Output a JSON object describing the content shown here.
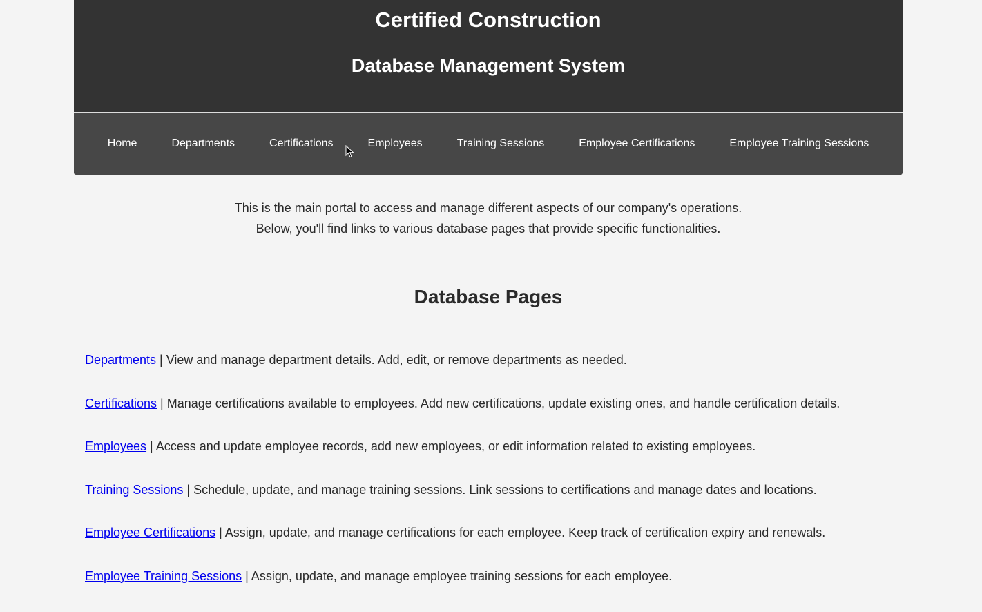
{
  "header": {
    "title": "Certified Construction",
    "subtitle": "Database Management System"
  },
  "nav": {
    "items": [
      {
        "label": "Home"
      },
      {
        "label": "Departments"
      },
      {
        "label": "Certifications"
      },
      {
        "label": "Employees"
      },
      {
        "label": "Training Sessions"
      },
      {
        "label": "Employee Certifications"
      },
      {
        "label": "Employee Training Sessions"
      }
    ]
  },
  "intro": {
    "line1": "This is the main portal to access and manage different aspects of our company's operations.",
    "line2": "Below, you'll find links to various database pages that provide specific functionalities."
  },
  "section": {
    "title": "Database Pages"
  },
  "pages": [
    {
      "link": "Departments",
      "desc": " | View and manage department details. Add, edit, or remove departments as needed."
    },
    {
      "link": "Certifications",
      "desc": " | Manage certifications available to employees. Add new certifications, update existing ones, and handle certification details."
    },
    {
      "link": "Employees",
      "desc": " | Access and update employee records, add new employees, or edit information related to existing employees."
    },
    {
      "link": "Training Sessions",
      "desc": " | Schedule, update, and manage training sessions. Link sessions to certifications and manage dates and locations."
    },
    {
      "link": "Employee Certifications",
      "desc": " | Assign, update, and manage certifications for each employee. Keep track of certification expiry and renewals."
    },
    {
      "link": "Employee Training Sessions",
      "desc": " | Assign, update, and manage employee training sessions for each employee."
    }
  ],
  "colors": {
    "header_bg": "#333333",
    "nav_bg": "#474747",
    "page_bg": "#f4f4f4",
    "link": "#0000ee"
  }
}
